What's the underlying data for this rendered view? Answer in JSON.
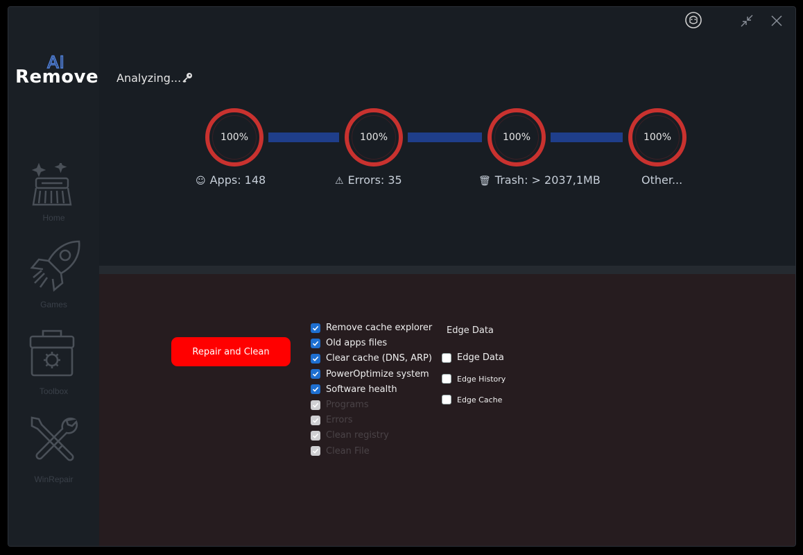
{
  "app": {
    "logo_ai": "AI",
    "logo_remove": "Remove",
    "colors": {
      "accent_red": "#ff0000",
      "ring_red": "#c9322f",
      "connector_blue": "#1f3e8a",
      "checkbox_blue": "#1e6fd0"
    }
  },
  "titlebar": {
    "buttons": [
      {
        "icon": "face-icon"
      },
      {
        "icon": "minimize-collapse-icon"
      },
      {
        "icon": "close-icon"
      }
    ]
  },
  "sidebar": {
    "items": [
      {
        "label": "Home",
        "icon": "broom-icon"
      },
      {
        "label": "Games",
        "icon": "rocket-icon"
      },
      {
        "label": "Toolbox",
        "icon": "toolbox-icon"
      },
      {
        "label": "WinRepair",
        "icon": "tools-icon"
      }
    ]
  },
  "status": {
    "text": "Analyzing...",
    "icon": "key-icon"
  },
  "progress": {
    "rings": [
      {
        "value": "100%",
        "progress": 1.0
      },
      {
        "value": "100%",
        "progress": 1.0
      },
      {
        "value": "100%",
        "progress": 1.0
      },
      {
        "value": "100%",
        "progress": 1.0
      }
    ],
    "stats": [
      {
        "icon": "apps-icon",
        "glyph": "☺",
        "text": "Apps: 148"
      },
      {
        "icon": "warning-icon",
        "glyph": "⚠",
        "text": "Errors: 35"
      },
      {
        "icon": "trash-icon",
        "glyph": "🗑",
        "text": "Trash: > 2037,1MB"
      },
      {
        "icon": "",
        "glyph": "",
        "text": "Other..."
      }
    ]
  },
  "actions": {
    "repair_label": "Repair and Clean"
  },
  "options": {
    "items": [
      {
        "label": "Remove cache explorer",
        "checked": true,
        "enabled": true
      },
      {
        "label": "Old apps files",
        "checked": true,
        "enabled": true
      },
      {
        "label": "Clear cache (DNS, ARP)",
        "checked": true,
        "enabled": true
      },
      {
        "label": "PowerOptimize system",
        "checked": true,
        "enabled": true
      },
      {
        "label": "Software health",
        "checked": true,
        "enabled": true
      },
      {
        "label": "Programs",
        "checked": true,
        "enabled": false
      },
      {
        "label": "Errors",
        "checked": true,
        "enabled": false
      },
      {
        "label": "Clean registry",
        "checked": true,
        "enabled": false
      },
      {
        "label": "Clean File",
        "checked": true,
        "enabled": false
      }
    ]
  },
  "edge": {
    "header": "Edge Data",
    "items": [
      {
        "label": "Edge Data",
        "checked": false
      },
      {
        "label": "Edge History",
        "checked": false
      },
      {
        "label": "Edge Cache",
        "checked": false
      }
    ]
  }
}
